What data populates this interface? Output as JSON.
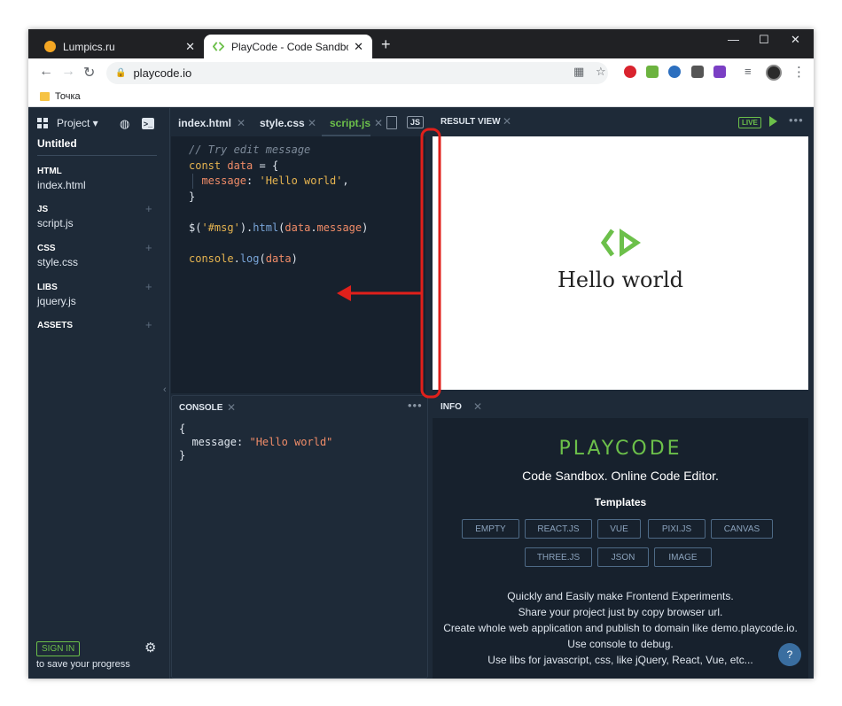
{
  "browser": {
    "tabs": [
      {
        "title": "Lumpics.ru",
        "favicon_color": "#f4a623"
      },
      {
        "title": "PlayCode - Code Sandbox. Onlin",
        "favicon_color": "#6cc04a"
      }
    ],
    "url": "playcode.io",
    "bookmark": "Точка"
  },
  "sidebar": {
    "project_label": "Project ▾",
    "untitled": "Untitled",
    "sections": [
      {
        "header": "HTML",
        "file": "index.html"
      },
      {
        "header": "JS",
        "file": "script.js"
      },
      {
        "header": "CSS",
        "file": "style.css"
      },
      {
        "header": "LIBS",
        "file": "jquery.js"
      },
      {
        "header": "ASSETS",
        "file": ""
      }
    ],
    "sign_in": "SIGN IN",
    "save_hint": "to save your progress"
  },
  "editor": {
    "tabs": [
      "index.html",
      "style.css",
      "script.js"
    ],
    "active_tab": "script.js",
    "lang_badge": "JS"
  },
  "code_lines": [
    [
      {
        "t": "// Try edit message",
        "c": "com"
      }
    ],
    [
      {
        "t": "const ",
        "c": "kw"
      },
      {
        "t": "data",
        "c": "var"
      },
      {
        "t": " = {",
        "c": "plain"
      }
    ],
    [
      {
        "t": "  message",
        "c": "var"
      },
      {
        "t": ": ",
        "c": "plain"
      },
      {
        "t": "'Hello world'",
        "c": "str"
      },
      {
        "t": ",",
        "c": "plain"
      }
    ],
    [
      {
        "t": "}",
        "c": "plain"
      }
    ],
    [],
    [
      {
        "t": "$(",
        "c": "plain"
      },
      {
        "t": "'#msg'",
        "c": "str"
      },
      {
        "t": ").",
        "c": "plain"
      },
      {
        "t": "html",
        "c": "fn"
      },
      {
        "t": "(",
        "c": "plain"
      },
      {
        "t": "data",
        "c": "var"
      },
      {
        "t": ".",
        "c": "plain"
      },
      {
        "t": "message",
        "c": "var"
      },
      {
        "t": ")",
        "c": "plain"
      }
    ],
    [],
    [
      {
        "t": "console",
        "c": "kw"
      },
      {
        "t": ".",
        "c": "plain"
      },
      {
        "t": "log",
        "c": "fn"
      },
      {
        "t": "(",
        "c": "plain"
      },
      {
        "t": "data",
        "c": "var"
      },
      {
        "t": ")",
        "c": "plain"
      }
    ]
  ],
  "console": {
    "title": "CONSOLE",
    "open": "{",
    "key": "  message: ",
    "value": "\"Hello world\"",
    "close": "}"
  },
  "result": {
    "title": "RESULT VIEW",
    "live": "LIVE",
    "hello": "Hello world"
  },
  "info": {
    "title": "INFO",
    "brand": "PLAYCODE",
    "subtitle": "Code Sandbox. Online Code Editor.",
    "templates_label": "Templates",
    "templates_row1": [
      "EMPTY",
      "REACT.JS",
      "VUE",
      "PIXI.JS",
      "CANVAS"
    ],
    "templates_row2": [
      "THREE.JS",
      "JSON",
      "IMAGE"
    ],
    "lines": [
      "Quickly and Easily make Frontend Experiments.",
      "Share your project just by copy browser url.",
      "Create whole web application and publish to domain like demo.playcode.io.",
      "Use console to debug.",
      "Use libs for javascript, css, like jQuery, React, Vue, etc..."
    ],
    "help": "?"
  },
  "colors": {
    "accent_green": "#6cc04a",
    "annotation_red": "#e0201b",
    "panel_dark": "#1e2a38"
  }
}
